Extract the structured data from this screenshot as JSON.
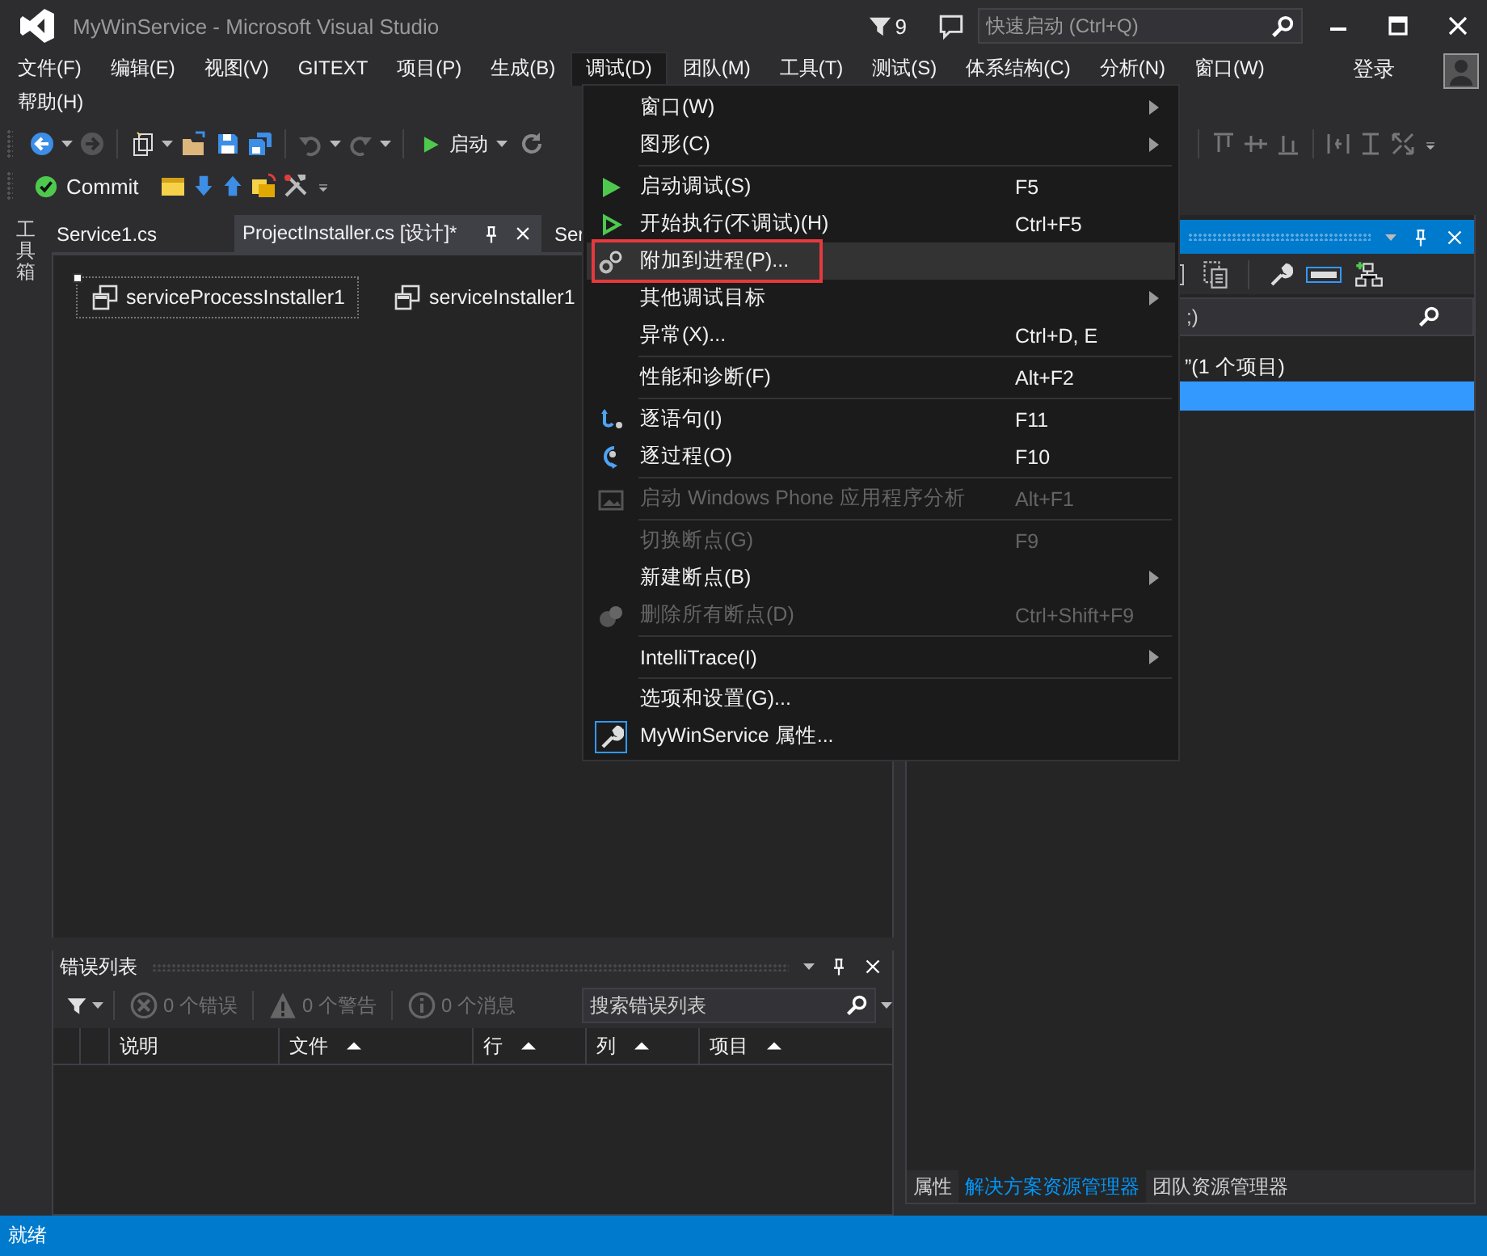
{
  "window": {
    "title": "MyWinService - Microsoft Visual Studio",
    "notification_count": "9",
    "quick_launch": {
      "placeholder": "快速启动 (Ctrl+Q)"
    }
  },
  "menu_bar": {
    "items": [
      {
        "label": "文件(F)",
        "selected": false
      },
      {
        "label": "编辑(E)",
        "selected": false
      },
      {
        "label": "视图(V)",
        "selected": false
      },
      {
        "label": "GITEXT",
        "selected": false
      },
      {
        "label": "项目(P)",
        "selected": false
      },
      {
        "label": "生成(B)",
        "selected": false
      },
      {
        "label": "调试(D)",
        "selected": true
      },
      {
        "label": "团队(M)",
        "selected": false
      },
      {
        "label": "工具(T)",
        "selected": false
      },
      {
        "label": "测试(S)",
        "selected": false
      },
      {
        "label": "体系结构(C)",
        "selected": false
      },
      {
        "label": "分析(N)",
        "selected": false
      },
      {
        "label": "窗口(W)",
        "selected": false
      },
      {
        "label": "帮助(H)",
        "selected": false
      }
    ],
    "account": "登录"
  },
  "toolbar": {
    "start_label": "启动",
    "commit_label": "Commit"
  },
  "toolbox": {
    "label": "工具箱"
  },
  "document_tabs": [
    {
      "label": "Service1.cs",
      "selected": false
    },
    {
      "label": "ProjectInstaller.cs [设计]*",
      "selected": true
    },
    {
      "label": "Ser",
      "selected": false
    }
  ],
  "designer": {
    "components": [
      {
        "label": "serviceProcessInstaller1",
        "selected": true
      },
      {
        "label": "serviceInstaller1",
        "selected": false
      }
    ]
  },
  "debug_menu": {
    "items": [
      {
        "kind": "item",
        "label": "窗口(W)",
        "submenu": true,
        "disabled": false,
        "selected": false
      },
      {
        "kind": "item",
        "label": "图形(C)",
        "submenu": true,
        "disabled": false,
        "selected": false
      },
      {
        "kind": "separator"
      },
      {
        "kind": "item",
        "label": "启动调试(S)",
        "shortcut": "F5",
        "disabled": false,
        "selected": false
      },
      {
        "kind": "item",
        "label": "开始执行(不调试)(H)",
        "shortcut": "Ctrl+F5",
        "disabled": false,
        "selected": false
      },
      {
        "kind": "item",
        "label": "附加到进程(P)...",
        "disabled": false,
        "selected": true,
        "annotated": true
      },
      {
        "kind": "item",
        "label": "其他调试目标",
        "submenu": true,
        "disabled": false,
        "selected": false
      },
      {
        "kind": "item",
        "label": "异常(X)...",
        "shortcut": "Ctrl+D, E",
        "disabled": false,
        "selected": false
      },
      {
        "kind": "separator"
      },
      {
        "kind": "item",
        "label": "性能和诊断(F)",
        "shortcut": "Alt+F2",
        "disabled": false,
        "selected": false
      },
      {
        "kind": "separator"
      },
      {
        "kind": "item",
        "label": "逐语句(I)",
        "shortcut": "F11",
        "disabled": false,
        "selected": false
      },
      {
        "kind": "item",
        "label": "逐过程(O)",
        "shortcut": "F10",
        "disabled": false,
        "selected": false
      },
      {
        "kind": "separator"
      },
      {
        "kind": "item",
        "label": "启动 Windows Phone 应用程序分析",
        "shortcut": "Alt+F1",
        "disabled": true,
        "selected": false
      },
      {
        "kind": "separator"
      },
      {
        "kind": "item",
        "label": "切换断点(G)",
        "shortcut": "F9",
        "disabled": true,
        "selected": false
      },
      {
        "kind": "item",
        "label": "新建断点(B)",
        "submenu": true,
        "disabled": false,
        "selected": false
      },
      {
        "kind": "item",
        "label": "删除所有断点(D)",
        "shortcut": "Ctrl+Shift+F9",
        "disabled": true,
        "selected": false
      },
      {
        "kind": "separator"
      },
      {
        "kind": "item",
        "label": "IntelliTrace(I)",
        "submenu": true,
        "disabled": false,
        "selected": false
      },
      {
        "kind": "separator"
      },
      {
        "kind": "item",
        "label": "选项和设置(G)...",
        "disabled": false,
        "selected": false
      },
      {
        "kind": "item",
        "label": "MyWinService 属性...",
        "disabled": false,
        "selected": false
      }
    ]
  },
  "error_list": {
    "title": "错误列表",
    "filters": [
      {
        "label": "0 个错误"
      },
      {
        "label": "0 个警告"
      },
      {
        "label": "0 个消息"
      }
    ],
    "search": {
      "placeholder": "搜索错误列表"
    },
    "columns": [
      {
        "label": "说明",
        "sorted": false
      },
      {
        "label": "文件",
        "sorted": true
      },
      {
        "label": "行",
        "sorted": true
      },
      {
        "label": "列",
        "sorted": true
      },
      {
        "label": "项目",
        "sorted": true
      }
    ]
  },
  "solution_explorer": {
    "search": {
      "value": ";)"
    },
    "tree": [
      {
        "label": "”(1 个项目)",
        "selected": false
      },
      {
        "selected": true
      }
    ],
    "tabs": [
      {
        "label": "属性",
        "selected": false
      },
      {
        "label": "解决方案资源管理器",
        "selected": true
      },
      {
        "label": "团队资源管理器",
        "selected": false
      }
    ]
  },
  "status_bar": {
    "text": "就绪"
  }
}
